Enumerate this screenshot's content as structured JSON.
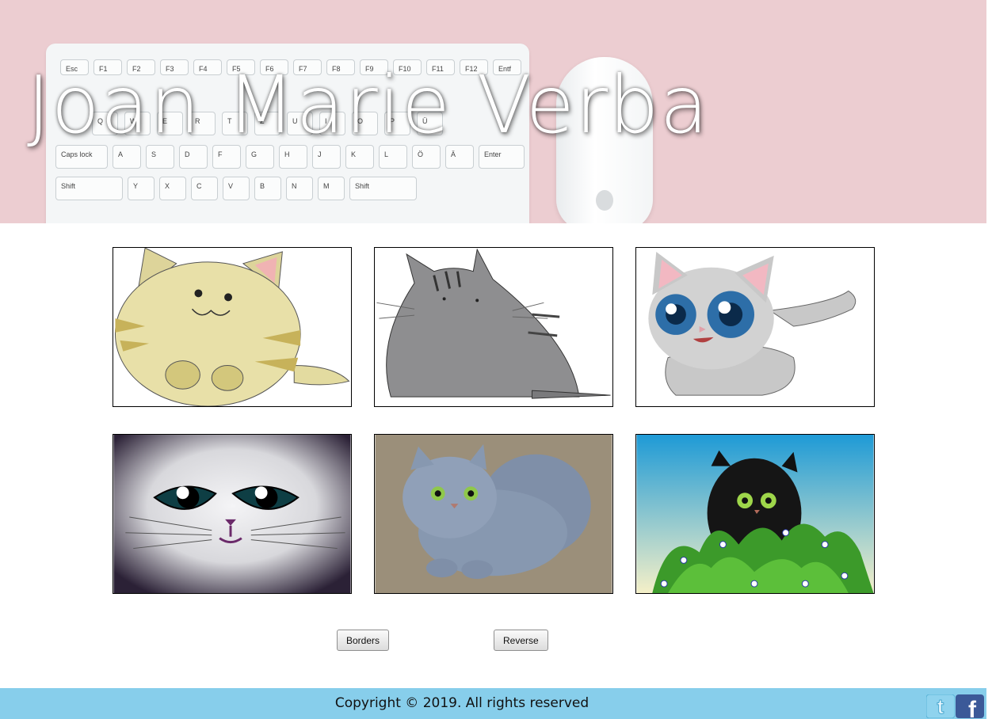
{
  "header": {
    "title": "Joan Marie Verba",
    "keyboard_keys": [
      "Esc",
      "F1",
      "F2",
      "F3",
      "F4",
      "F5",
      "F6",
      "F7",
      "F8",
      "F9",
      "F10",
      "F11",
      "F12",
      "Entf",
      "Q",
      "W",
      "E",
      "R",
      "T",
      "Z",
      "U",
      "I",
      "O",
      "P",
      "Ü",
      "Caps lock",
      "A",
      "S",
      "D",
      "F",
      "G",
      "H",
      "J",
      "K",
      "L",
      "Ö",
      "Ä",
      "Enter",
      "Shift",
      "Y",
      "X",
      "C",
      "V",
      "B",
      "N",
      "M",
      "Shift"
    ]
  },
  "gallery": {
    "images": [
      {
        "name": "cat-yellow-round",
        "subject": "Yellow round cartoon cat"
      },
      {
        "name": "cat-gray-chubby",
        "subject": "Gray chubby cartoon cat"
      },
      {
        "name": "cat-gray-big-eyes",
        "subject": "Gray kitten with big blue eyes"
      },
      {
        "name": "cat-face-vignette",
        "subject": "Cat face with teal eyes on textured background"
      },
      {
        "name": "cat-fluffy-gray",
        "subject": "Fluffy gray Persian kitten"
      },
      {
        "name": "cat-black-flowers",
        "subject": "Black kitten in leaves with flowers"
      }
    ]
  },
  "controls": {
    "borders_label": "Borders",
    "reverse_label": "Reverse"
  },
  "footer": {
    "copyright": "Copyright © 2019. All rights reserved",
    "twitter_icon": "twitter-icon",
    "facebook_icon": "facebook-icon"
  },
  "colors": {
    "banner_bg": "#eccdd1",
    "footer_bg": "#87ceeb",
    "thumb_border": "#000000"
  }
}
